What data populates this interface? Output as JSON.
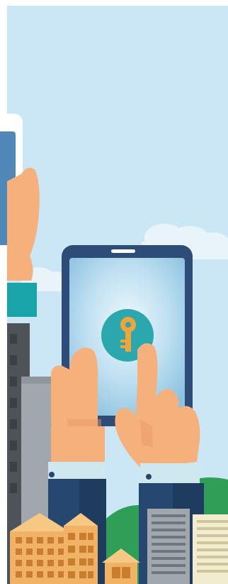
{
  "scene": {
    "colors": {
      "sky": "#cbe7f5",
      "cloud": "#e8f4fa",
      "skin": "#f5b07c",
      "skin_shadow": "#e89a64",
      "tablet_frame": "#2e4c78",
      "tablet_screen": "#b7dcef",
      "screen_glow": "#eef8fd",
      "key_circle": "#2aa8ae",
      "key": "#f2a33a",
      "sleeve_navy": "#26476f",
      "sleeve_navy_dark": "#1f3b5e",
      "cuff": "#cfe8f0",
      "hill": "#2f9e57",
      "building_orange": "#f0b265",
      "building_grey": "#a0a7ad",
      "building_dark": "#4d5358",
      "teal_accent": "#18a4a8"
    },
    "icons": {
      "center": "key-icon",
      "unlock_badge": "key-badge-icon"
    }
  }
}
